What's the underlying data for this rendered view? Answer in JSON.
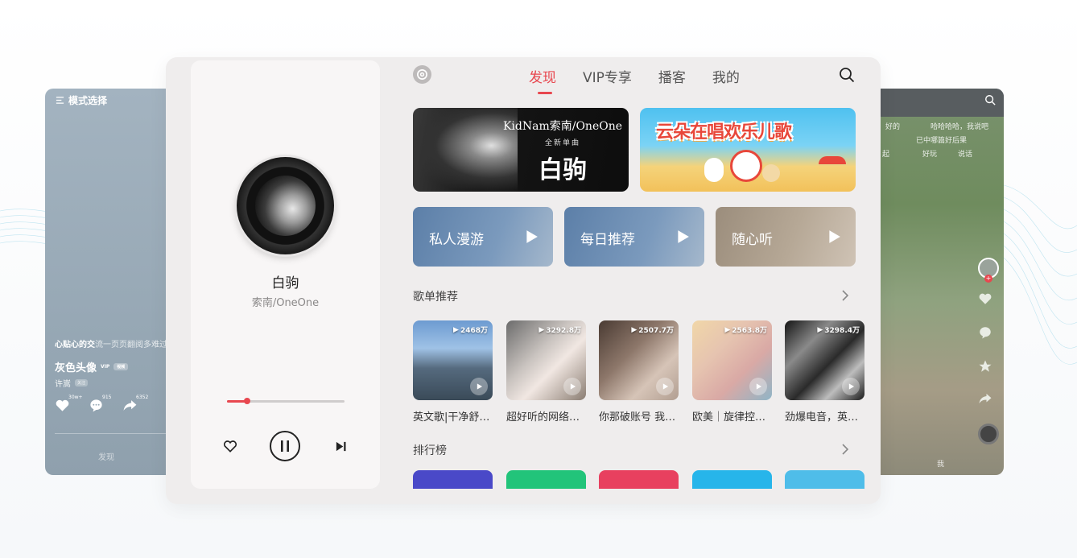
{
  "left_card": {
    "mode_label": "模式选择",
    "lyric_strong": "心贴心的交",
    "lyric_rest": "流一页页翻阅多难过",
    "song_name": "灰色头像",
    "vip_badge": "VIP",
    "tag_badge": "视频",
    "author": "许嵩",
    "follow_badge": "关注",
    "likes": "30w+",
    "comments": "915",
    "shares": "6352",
    "nav_label": "发现"
  },
  "right_card": {
    "danmaku": [
      "好的",
      "哈哈哈哈，我说吧",
      "已中哪篇好后果",
      "好玩",
      "说话",
      "起"
    ],
    "nav_label": "我"
  },
  "player": {
    "title": "白驹",
    "artist": "索南/OneOne",
    "progress": 0.17
  },
  "header": {
    "tabs": [
      {
        "label": "发现",
        "active": true
      },
      {
        "label": "VIP专享",
        "active": false
      },
      {
        "label": "播客",
        "active": false
      },
      {
        "label": "我的",
        "active": false
      }
    ]
  },
  "banners": [
    {
      "artist": "KidNam索南/OneOne",
      "tag": "全新单曲",
      "title": "白驹"
    },
    {
      "title": "云朵在唱欢乐儿歌"
    }
  ],
  "quick_actions": [
    {
      "label": "私人漫游"
    },
    {
      "label": "每日推荐"
    },
    {
      "label": "随心听"
    }
  ],
  "sections": {
    "playlists_title": "歌单推荐",
    "charts_title": "排行榜"
  },
  "playlists": [
    {
      "count": "2468万",
      "name": "英文歌|干净舒适的音乐"
    },
    {
      "count": "3292.8万",
      "name": "超好听的网络热歌"
    },
    {
      "count": "2507.7万",
      "name": "你那破账号 我早就不用了"
    },
    {
      "count": "2563.8万",
      "name": "欧美｜旋律控的耳朵"
    },
    {
      "count": "3298.4万",
      "name": "劲爆电音，英文歌曲"
    }
  ],
  "colors": {
    "accent": "#e8474f",
    "rank_colors": [
      "#4a49c8",
      "#22c47a",
      "#e8405f",
      "#27b5ea",
      "#4fbde9"
    ]
  }
}
